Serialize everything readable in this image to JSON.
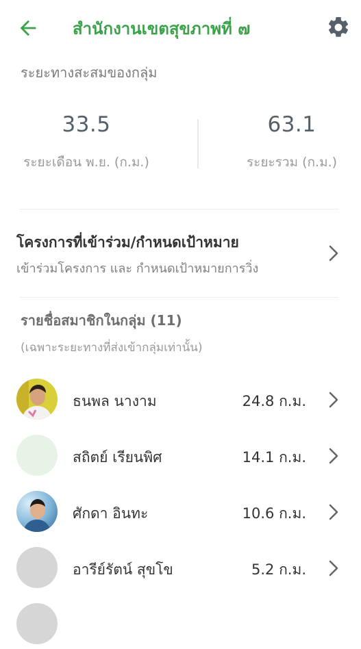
{
  "header": {
    "title": "สำนักงานเขตสุขภาพที่ ๗",
    "colors": {
      "accent": "#3aa34a",
      "icon": "#56606a"
    }
  },
  "accumulated": {
    "heading": "ระยะทางสะสมของกลุ่ม",
    "monthly": {
      "value": "33.5",
      "caption": "ระยะเดือน พ.ย. (ก.ม.)"
    },
    "total": {
      "value": "63.1",
      "caption": "ระยะรวม (ก.ม.)"
    }
  },
  "project": {
    "title": "โครงการที่เข้าร่วม/กำหนดเป้าหมาย",
    "subtitle": "เข้าร่วมโครงการ และ กำหนดเป้าหมายการวิ่ง"
  },
  "members": {
    "heading": "รายชื่อสมาชิกในกลุ่ม (11)",
    "note": "(เฉพาะระยะทางที่ส่งเข้ากลุ่มเท่านั้น)",
    "list": [
      {
        "name": "ธนพล นางาม",
        "distance": "24.8 ก.ม.",
        "avatar": "photo-man-yellow-background"
      },
      {
        "name": "สถิตย์ เรียนพิศ",
        "distance": "14.1 ก.ม.",
        "avatar": "placeholder-light-green"
      },
      {
        "name": "ศักดา อินทะ",
        "distance": "10.6 ก.ม.",
        "avatar": "photo-man-blue-background"
      },
      {
        "name": "อารีย์รัตน์ สุขโข",
        "distance": "5.2 ก.ม.",
        "avatar": "placeholder-grey"
      }
    ]
  }
}
